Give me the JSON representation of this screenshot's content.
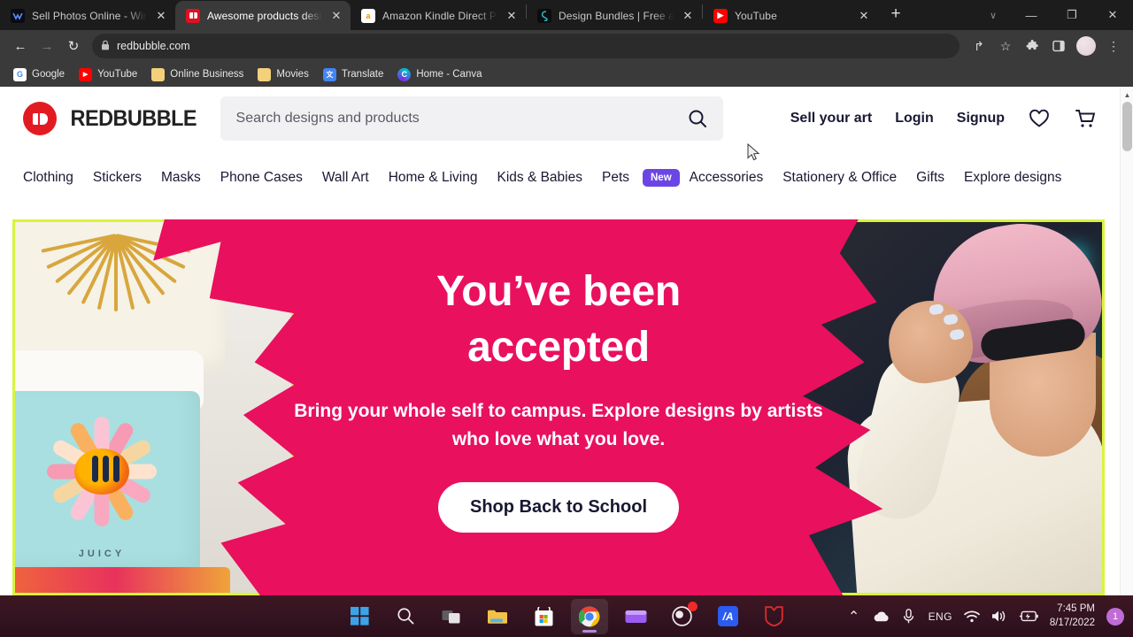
{
  "browser": {
    "tabs": [
      {
        "title": "Sell Photos Online - Wires",
        "favicon": "wirestock-icon",
        "active": false,
        "close_label": "✕"
      },
      {
        "title": "Awesome products design",
        "favicon": "redbubble-icon",
        "active": true,
        "close_label": "✕"
      },
      {
        "title": "Amazon Kindle Direct Pub",
        "favicon": "amazon-icon",
        "active": false,
        "close_label": "✕"
      },
      {
        "title": "Design Bundles | Free and",
        "favicon": "designbundles-icon",
        "active": false,
        "close_label": "✕"
      },
      {
        "title": "YouTube",
        "favicon": "youtube-icon",
        "active": false,
        "close_label": "✕"
      }
    ],
    "new_tab_label": "+",
    "window_controls": {
      "chevron": "∨",
      "minimize": "—",
      "maximize": "❐",
      "close": "✕"
    },
    "nav": {
      "back": "←",
      "forward": "→",
      "reload": "↻"
    },
    "omnibox": {
      "lock": "🔒",
      "url": "redbubble.com"
    },
    "omni_actions": {
      "share": "↱",
      "bookmark": "☆",
      "extensions": "❖",
      "sidepanel": "▣",
      "menu": "⋮"
    },
    "bookmarks": [
      {
        "label": "Google",
        "icon": "google-icon",
        "glyph": "G"
      },
      {
        "label": "YouTube",
        "icon": "youtube-icon",
        "glyph": "▶"
      },
      {
        "label": "Online Business",
        "icon": "folder-icon",
        "glyph": ""
      },
      {
        "label": "Movies",
        "icon": "folder-icon",
        "glyph": ""
      },
      {
        "label": "Translate",
        "icon": "translate-icon",
        "glyph": "文"
      },
      {
        "label": "Home - Canva",
        "icon": "canva-icon",
        "glyph": "C"
      }
    ]
  },
  "page": {
    "brand": "REDBUBBLE",
    "search": {
      "placeholder": "Search designs and products"
    },
    "header_links": [
      "Sell your art",
      "Login",
      "Signup"
    ],
    "header_icons": [
      "heart-icon",
      "cart-icon"
    ],
    "categories": [
      {
        "label": "Clothing"
      },
      {
        "label": "Stickers"
      },
      {
        "label": "Masks"
      },
      {
        "label": "Phone Cases"
      },
      {
        "label": "Wall Art"
      },
      {
        "label": "Home & Living"
      },
      {
        "label": "Kids & Babies"
      },
      {
        "label": "Pets",
        "badge": "New"
      },
      {
        "label": "Accessories"
      },
      {
        "label": "Stationery & Office"
      },
      {
        "label": "Gifts"
      },
      {
        "label": "Explore designs"
      }
    ],
    "hero": {
      "title_line1": "You’ve been",
      "title_line2": "accepted",
      "subtitle": "Bring your whole self to campus. Explore designs by artists who love what you love.",
      "cta": "Shop Back to School",
      "background_color": "#e9105e",
      "accent_color": "#d9f43c",
      "left_image_caption": "JUICY"
    },
    "accent_colors": {
      "brand_red": "#e21b22",
      "badge_purple": "#6b46e5",
      "hero_pink": "#e9105e",
      "neon": "#d9f43c"
    }
  },
  "taskbar": {
    "apps": [
      {
        "name": "start-icon"
      },
      {
        "name": "search-icon"
      },
      {
        "name": "task-view-icon"
      },
      {
        "name": "file-explorer-icon"
      },
      {
        "name": "microsoft-store-icon"
      },
      {
        "name": "chrome-icon",
        "active": true
      },
      {
        "name": "purple-app-icon"
      },
      {
        "name": "obs-icon",
        "badge": true
      },
      {
        "name": "blue-a-icon",
        "glyph": "/A"
      },
      {
        "name": "shield-app-icon"
      }
    ],
    "tray": {
      "chevron": "⌃",
      "onedrive": "onedrive-icon",
      "microphone": "microphone-icon",
      "language": "ENG",
      "wifi": "wifi-icon",
      "volume": "volume-icon",
      "battery": "battery-charging-icon",
      "time": "7:45 PM",
      "date": "8/17/2022",
      "notification_count": "1"
    }
  }
}
